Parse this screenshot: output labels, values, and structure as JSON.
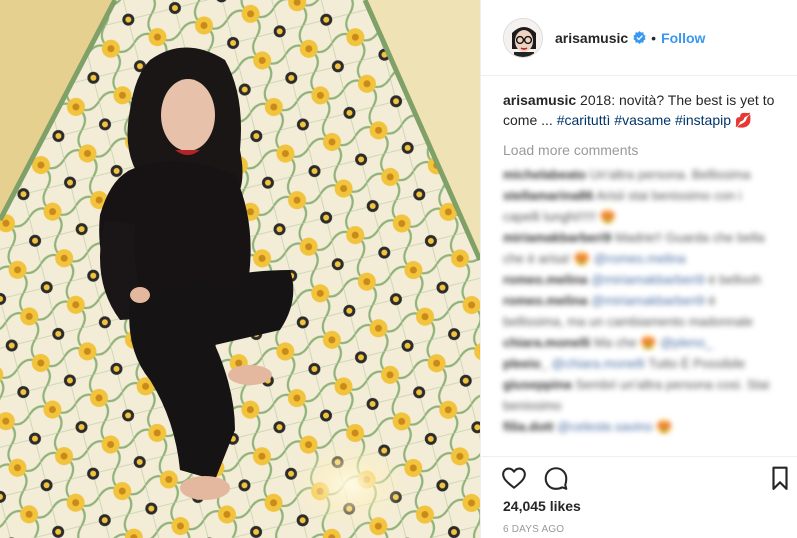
{
  "post": {
    "image_alt": "arisamusic photo on tiled floor",
    "author": "arisamusic",
    "follow_label": "Follow",
    "separator": "•",
    "caption": {
      "username": "arisamusic",
      "text": " 2018: novità? The best is yet to come ... ",
      "hashtags": [
        "#carituttì",
        "#vasame",
        "#instapip"
      ],
      "emoji": "💋"
    },
    "load_more_label": "Load more comments",
    "comments": [
      {
        "user": "michelabeato",
        "text": "Un'altra persona. Bellissima"
      },
      {
        "user": "stellamarina86",
        "text": "Arisii stai benissimo con i capelli lunghi!!!!! 😍"
      },
      {
        "user": "miriamakbarberi9",
        "text": "Madrie!! Guarda che bella che è arisa! 😍 ",
        "mention": "@romeo.melina"
      },
      {
        "user": "romeo.melina",
        "text": " è bellooh",
        "mention": "@miriamakbarberi9"
      },
      {
        "user": "romeo.melina",
        "text": " è bellissima, ma un cambiamento madonnale",
        "mention": "@miriamakbarberi9"
      },
      {
        "user": "chiara.monelli",
        "text": "Ma che 😍 ",
        "mention": "@pleno_"
      },
      {
        "user": "pleeio_",
        "text": " Tutto È Possibile",
        "mention": "@chiara.monelli"
      },
      {
        "user": "giuseppina",
        "text": "Sembri un'altra persona cosi. Stai benissimo"
      },
      {
        "user": "filia.dott",
        "text": " 😍",
        "mention": "@celeste.savino"
      }
    ],
    "likes": "24,045 likes",
    "time_ago": "6 DAYS AGO"
  },
  "icons": {
    "verified": "verified-badge-icon",
    "like": "heart-icon",
    "comment": "comment-bubble-icon",
    "save": "bookmark-icon"
  },
  "colors": {
    "follow_blue": "#3897f0",
    "hashtag": "#003569",
    "verified_blue": "#3897f0",
    "muted": "#999999"
  }
}
